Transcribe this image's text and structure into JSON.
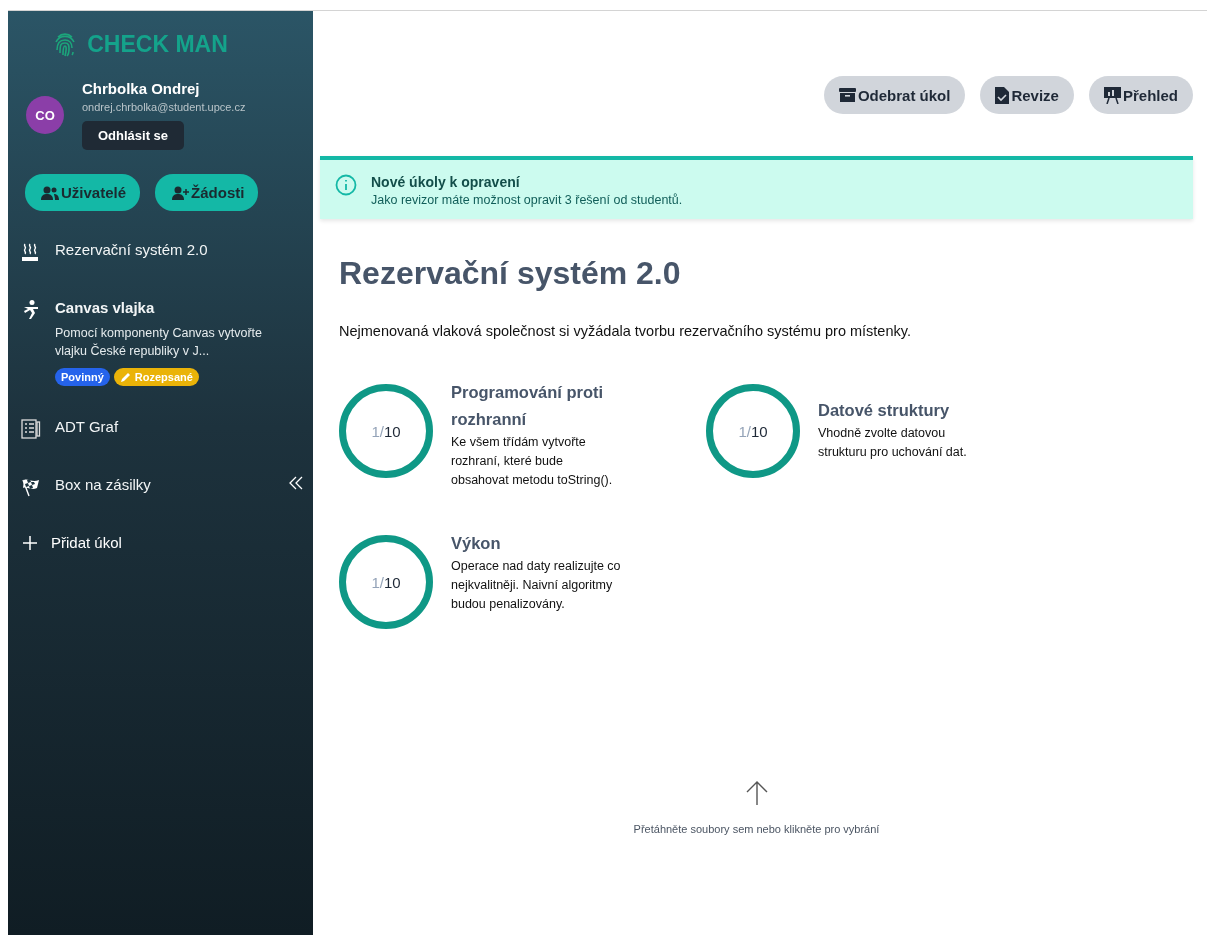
{
  "sidebar": {
    "logo": "CHECK MAN",
    "user": {
      "initials": "CO",
      "name": "Chrbolka Ondrej",
      "email": "ondrej.chrbolka@student.upce.cz",
      "logout": "Odhlásit se"
    },
    "buttons": [
      "Uživatelé",
      "Žádosti"
    ],
    "tasks": [
      {
        "title": "Rezervační systém 2.0",
        "selected": false
      },
      {
        "title": "Canvas vlajka",
        "selected": true,
        "description": "Pomocí komponenty Canvas vytvořte vlajku České republiky v J...",
        "tags": [
          {
            "label": "Povinný",
            "color": "#2563eb"
          },
          {
            "label": "Rozepsané",
            "color": "#eab308"
          }
        ]
      },
      {
        "title": "ADT Graf",
        "selected": false
      },
      {
        "title": "Box na zásilky",
        "selected": false
      }
    ],
    "add_task": "Přidat úkol"
  },
  "toolbar": [
    "Odebrat úkol",
    "Revize",
    "Přehled"
  ],
  "alert": {
    "title": "Nové úkoly k opravení",
    "message": "Jako revizor máte možnost opravit 3 řešení od studentů."
  },
  "task": {
    "title": "Rezervační systém 2.0",
    "description": "Nejmenovaná vlaková společnost si vyžádala tvorbu rezervačního systému pro místenky.",
    "criteria": [
      {
        "score": "1/",
        "max": "10",
        "title": "Programování proti rozhranní",
        "text": "Ke všem třídám vytvořte rozhraní, které bude obsahovat metodu toString()."
      },
      {
        "score": "1/",
        "max": "10",
        "title": "Datové struktury",
        "text": "Vhodně zvolte datovou strukturu pro uchování dat."
      },
      {
        "score": "1/",
        "max": "10",
        "title": "Výkon",
        "text": "Operace nad daty realizujte co nejkvalitněji. Naivní algoritmy budou penalizovány."
      }
    ]
  },
  "upload": {
    "hint": "Přetáhněte soubory sem nebo klikněte pro vybrání"
  }
}
